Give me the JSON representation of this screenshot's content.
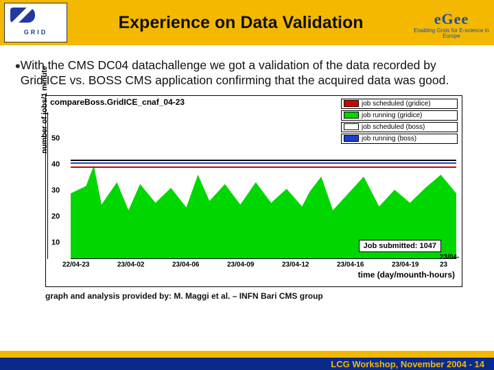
{
  "header": {
    "title": "Experience on Data Validation",
    "logo_infn_label": "GRID",
    "egee_label": "eGee",
    "egee_sub": "Enabling Grids for E-science in Europe"
  },
  "bullet": {
    "text": "With the CMS DC04 datachallenge we got a validation of the data recorded by Grid.ICE vs. BOSS CMS application confirming that the acquired data was good."
  },
  "chart": {
    "title": "compareBoss.GridICE_cnaf_04-23",
    "ylabel": "number of jobs/1 minute",
    "xlabel": "time (day/mounth-hours)",
    "yticks": [
      "10",
      "20",
      "30",
      "40",
      "50"
    ],
    "xticks": [
      "22/04-23",
      "23/04-02",
      "23/04-06",
      "23/04-09",
      "23/04-12",
      "23/04-16",
      "23/04-19",
      "23/04-23"
    ],
    "legend": [
      {
        "label": "job scheduled (gridice)",
        "color": "#d40000"
      },
      {
        "label": "job running   (gridice)",
        "color": "#00d600"
      },
      {
        "label": "job scheduled (boss)",
        "color": "#ffffff"
      },
      {
        "label": "job running   (boss)",
        "color": "#1a3fcf"
      }
    ],
    "label_box": "Job submitted: 1047"
  },
  "credit": "graph and analysis provided by: M. Maggi et al. – INFN Bari CMS group",
  "footer": "LCG Workshop,  November 2004  -  14"
}
